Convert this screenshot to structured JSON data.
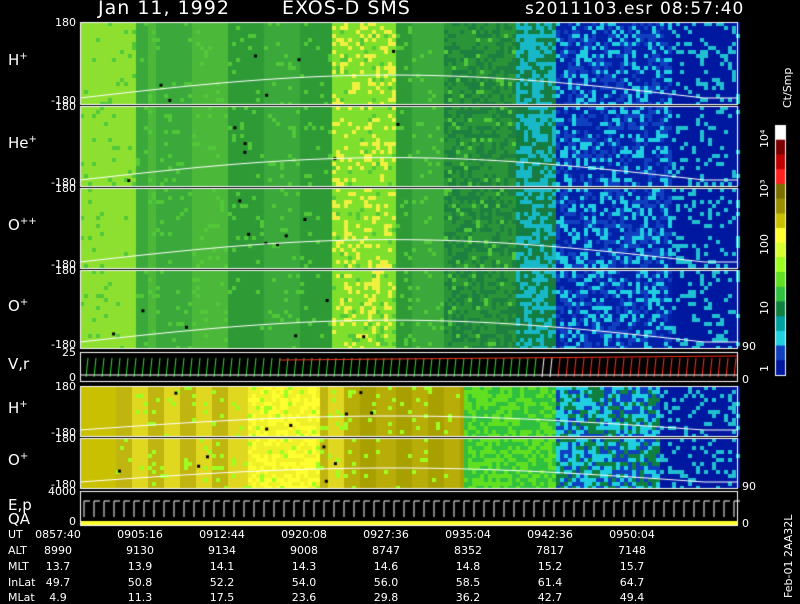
{
  "header": {
    "date": "Jan 11, 1992",
    "instrument": "EXOS-D SMS",
    "file": "s2011103.esr",
    "time": "08:57:40"
  },
  "chart_data": {
    "type": "heatmap",
    "panels": [
      {
        "label_main": "H",
        "label_sup": "+",
        "ymax": "180",
        "ymin": "-180",
        "style": "spectro"
      },
      {
        "label_main": "He",
        "label_sup": "+",
        "ymax": "180",
        "ymin": "-180",
        "style": "spectro"
      },
      {
        "label_main": "O",
        "label_sup": "++",
        "ymax": "180",
        "ymin": "-180",
        "style": "spectro"
      },
      {
        "label_main": "O",
        "label_sup": "+",
        "ymax": "180",
        "ymin": "-180",
        "style": "spectro",
        "right_tick": "90"
      },
      {
        "label_main": "V,r",
        "label_sup": "",
        "ymax": "25",
        "ymin": "0",
        "style": "lines",
        "right_tick": "0"
      },
      {
        "label_main": "H",
        "label_sup": "+",
        "ymax": "180",
        "ymin": "-180",
        "style": "yellow"
      },
      {
        "label_main": "O",
        "label_sup": "+",
        "ymax": "180",
        "ymin": "-180",
        "style": "yellow",
        "right_tick": "90"
      },
      {
        "label_main": "E,p",
        "label_sub": "QA",
        "ymax": "4000",
        "ymin": "0",
        "style": "energy",
        "right_tick": "0"
      }
    ],
    "colorbar": {
      "unit": "Ct/Smp",
      "labels": [
        "10⁴",
        "10³",
        "100",
        "10",
        "1"
      ],
      "colors": [
        "#ffffff",
        "#7a0000",
        "#c00000",
        "#ff2020",
        "#7a6f00",
        "#9a8f00",
        "#c8c000",
        "#ffff30",
        "#d8ff30",
        "#9cff20",
        "#60e020",
        "#30c040",
        "#108040",
        "#00a0a0",
        "#20d0e0",
        "#1040c0",
        "#0018a0"
      ]
    },
    "time_axis": {
      "row_labels": [
        "UT",
        "ALT",
        "MLT",
        "InLat",
        "MLat"
      ],
      "columns": [
        {
          "UT": "0857:40",
          "ALT": "8990",
          "MLT": "13.7",
          "InLat": "49.7",
          "MLat": "4.9"
        },
        {
          "UT": "0905:16",
          "ALT": "9130",
          "MLT": "13.9",
          "InLat": "50.8",
          "MLat": "11.3"
        },
        {
          "UT": "0912:44",
          "ALT": "9134",
          "MLT": "14.1",
          "InLat": "52.2",
          "MLat": "17.5"
        },
        {
          "UT": "0920:08",
          "ALT": "9008",
          "MLT": "14.3",
          "InLat": "54.0",
          "MLat": "23.6"
        },
        {
          "UT": "0927:36",
          "ALT": "8747",
          "MLT": "14.6",
          "InLat": "56.0",
          "MLat": "29.8"
        },
        {
          "UT": "0935:04",
          "ALT": "8352",
          "MLT": "14.8",
          "InLat": "58.5",
          "MLat": "36.2"
        },
        {
          "UT": "0942:36",
          "ALT": "7817",
          "MLT": "15.2",
          "InLat": "61.4",
          "MLat": "42.7"
        },
        {
          "UT": "0950:04",
          "ALT": "7148",
          "MLT": "15.7",
          "InLat": "64.7",
          "MLat": "49.4"
        }
      ]
    },
    "footer_note": "Feb-01 2AA32L"
  }
}
